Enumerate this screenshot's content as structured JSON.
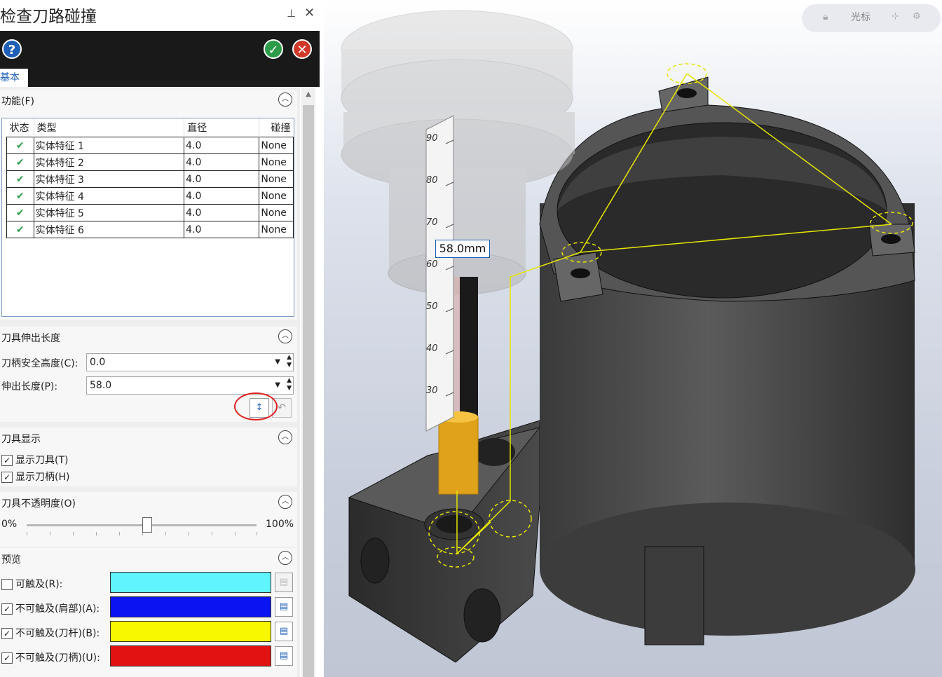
{
  "dialog": {
    "title": "检查刀路碰撞",
    "tab_basic": "基本"
  },
  "sections": {
    "function": {
      "title": "功能(F)",
      "columns": [
        "状态",
        "类型",
        "直径",
        "碰撞"
      ],
      "rows": [
        {
          "status": "✔",
          "type": "实体特征 1",
          "diameter": "4.0",
          "collision": "None"
        },
        {
          "status": "✔",
          "type": "实体特征 2",
          "diameter": "4.0",
          "collision": "None"
        },
        {
          "status": "✔",
          "type": "实体特征 3",
          "diameter": "4.0",
          "collision": "None"
        },
        {
          "status": "✔",
          "type": "实体特征 4",
          "diameter": "4.0",
          "collision": "None"
        },
        {
          "status": "✔",
          "type": "实体特征 5",
          "diameter": "4.0",
          "collision": "None"
        },
        {
          "status": "✔",
          "type": "实体特征 6",
          "diameter": "4.0",
          "collision": "None"
        }
      ]
    },
    "stickout": {
      "title": "刀具伸出长度",
      "holder_clearance_label": "刀柄安全高度(C):",
      "holder_clearance_value": "0.0",
      "stickout_label": "伸出长度(P):",
      "stickout_value": "58.0"
    },
    "display": {
      "title": "刀具显示",
      "show_tool_label": "显示刀具(T)",
      "show_tool_checked": true,
      "show_holder_label": "显示刀柄(H)",
      "show_holder_checked": true
    },
    "opacity": {
      "title": "刀具不透明度(O)",
      "min_label": "0%",
      "max_label": "100%",
      "value_percent": 52
    },
    "preview": {
      "title": "预览",
      "items": [
        {
          "label": "可触及(R):",
          "checked": false,
          "color": "#60f4ff"
        },
        {
          "label": "不可触及(肩部)(A):",
          "checked": true,
          "color": "#0a14f0"
        },
        {
          "label": "不可触及(刀杆)(B):",
          "checked": true,
          "color": "#f8f800"
        },
        {
          "label": "不可触及(刀柄)(U):",
          "checked": true,
          "color": "#e01212"
        }
      ]
    }
  },
  "viewport": {
    "toolbar_cursor_label": "光标",
    "measure_label": "58.0mm",
    "ruler_ticks": [
      "90",
      "80",
      "70",
      "60",
      "50",
      "40",
      "30"
    ]
  }
}
